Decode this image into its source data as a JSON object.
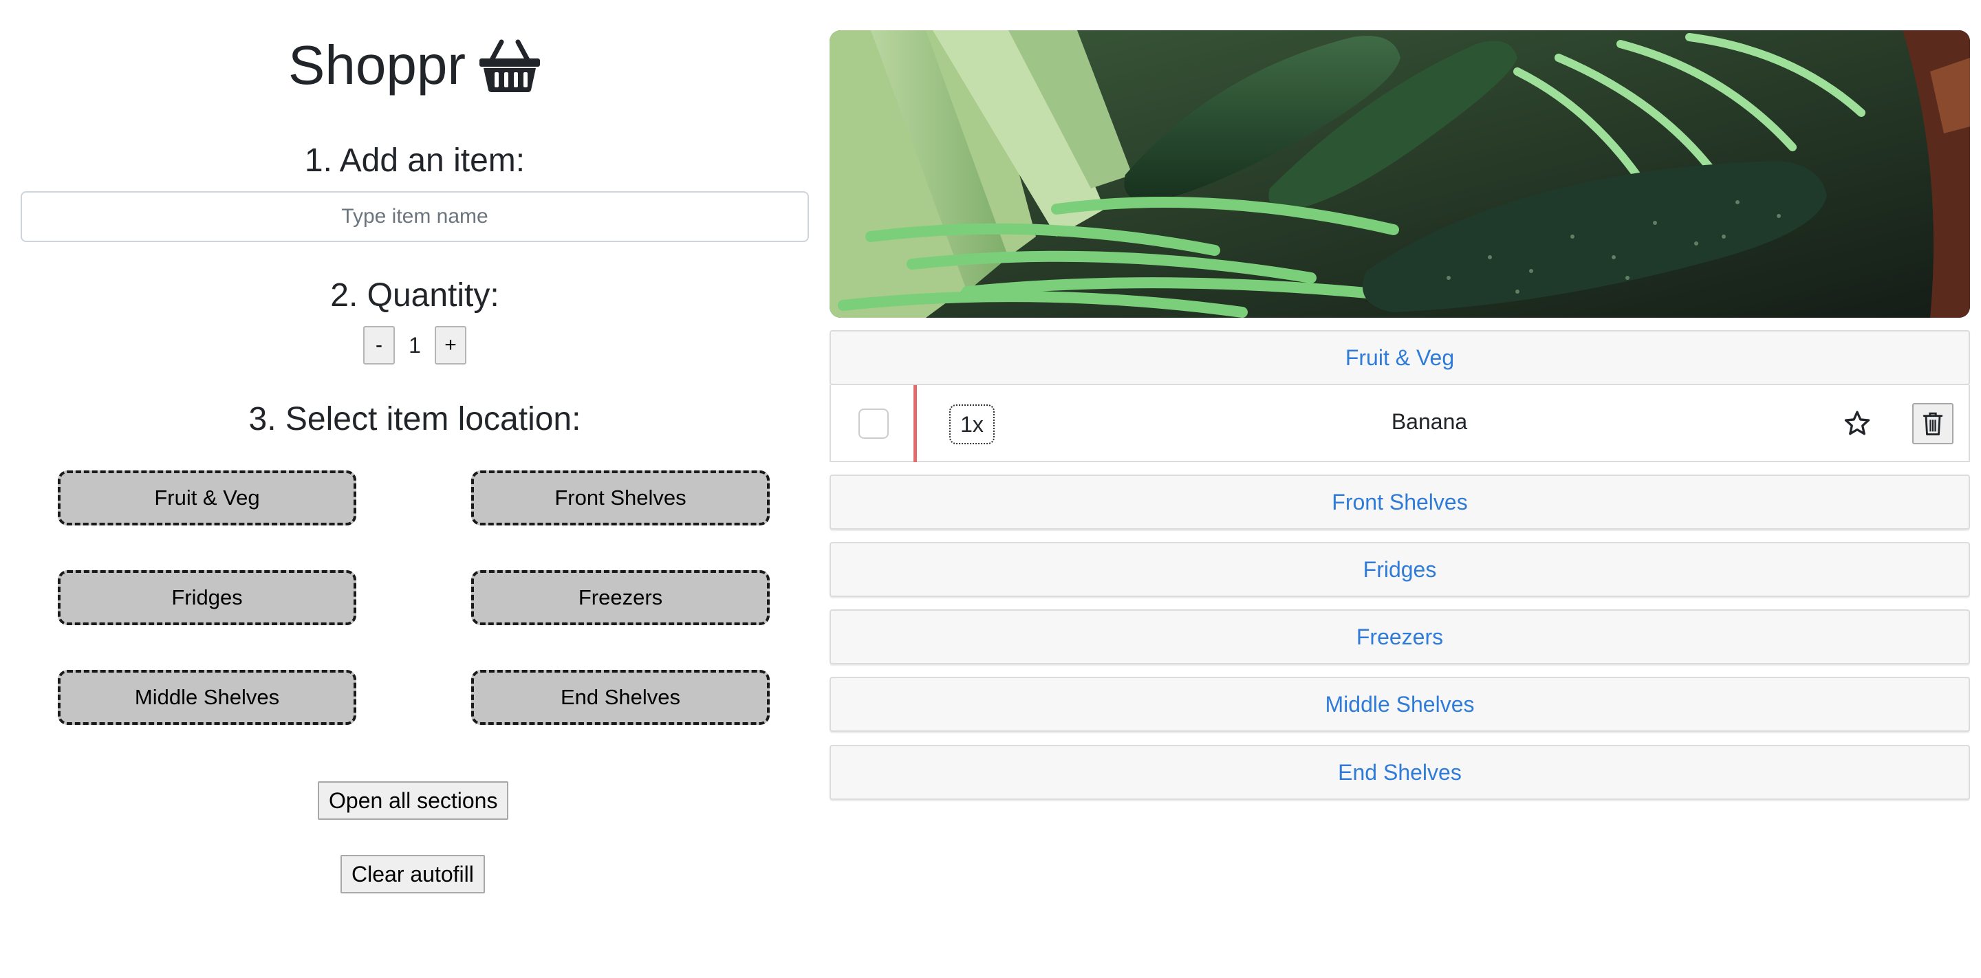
{
  "app": {
    "title": "Shoppr",
    "title_icon": "basket-icon"
  },
  "steps": {
    "add_item": "1. Add an item:",
    "quantity": "2. Quantity:",
    "location": "3. Select item location:"
  },
  "item_input": {
    "placeholder": "Type item name",
    "value": ""
  },
  "quantity": {
    "decrement_label": "-",
    "value": "1",
    "increment_label": "+"
  },
  "locations": [
    "Fruit & Veg",
    "Front Shelves",
    "Fridges",
    "Freezers",
    "Middle Shelves",
    "End Shelves"
  ],
  "actions": {
    "open_all": "Open all sections",
    "clear_autofill": "Clear autofill"
  },
  "sections": [
    {
      "label": "Fruit & Veg",
      "items": [
        {
          "quantity": "1x",
          "name": "Banana",
          "checked": false,
          "favorite": false
        }
      ]
    },
    {
      "label": "Front Shelves",
      "items": []
    },
    {
      "label": "Fridges",
      "items": []
    },
    {
      "label": "Freezers",
      "items": []
    },
    {
      "label": "Middle Shelves",
      "items": []
    },
    {
      "label": "End Shelves",
      "items": []
    }
  ],
  "colors": {
    "section_text": "#2f7bd9",
    "location_button_bg": "#c4c4c4",
    "item_marker": "#e26b6b"
  }
}
